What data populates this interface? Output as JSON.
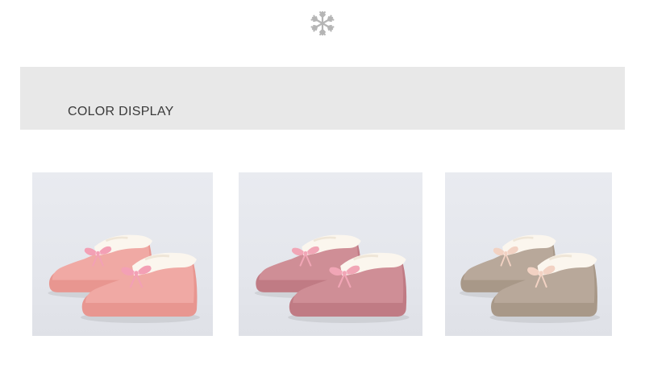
{
  "banner": {
    "title": "COLOR DISPLAY"
  },
  "colors": {
    "background": "#ffffff",
    "banner": "#e8e8e8",
    "snowflake": "#b5b5b5"
  },
  "swatches": [
    {
      "name": "pink",
      "body": "#f0a9a4",
      "sole": "#e89690",
      "bow": "#f3a0b5"
    },
    {
      "name": "rose",
      "body": "#cf8e96",
      "sole": "#c07b84",
      "bow": "#f1a6b6"
    },
    {
      "name": "khaki",
      "body": "#b8a89a",
      "sole": "#a89888",
      "bow": "#f2d2c3"
    }
  ]
}
